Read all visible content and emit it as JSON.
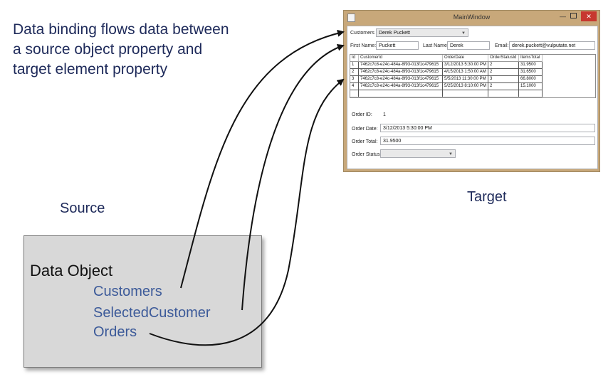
{
  "headline": [
    "Data binding flows data between",
    "a source object property and",
    "target element property"
  ],
  "source_label": "Source",
  "target_label": "Target",
  "data_object": {
    "title": "Data Object",
    "properties": [
      "Customers",
      "SelectedCustomer",
      "Orders"
    ]
  },
  "window": {
    "title": "MainWindow",
    "customers_label": "Customers",
    "customers_value": "Derek Puckett",
    "first_name_label": "First Name:",
    "first_name_value": "Puckett",
    "last_name_label": "Last Name:",
    "last_name_value": "Derek",
    "email_label": "Email:",
    "email_value": "derek.puckett@vulputate.net",
    "grid": {
      "headers": [
        "Id",
        "CustomerId",
        "OrderDate",
        "OrderStatusId",
        "ItemsTotal"
      ],
      "rows": [
        [
          "1",
          "7462c7c8-e24c-484a-8f93-013f1c479615",
          "3/12/2013 5:30:00 PM",
          "2",
          "31.9500"
        ],
        [
          "2",
          "7462c7c8-e24c-484a-8f93-013f1c479615",
          "4/15/2013 1:50:00 AM",
          "2",
          "31.6500"
        ],
        [
          "3",
          "7462c7c8-e24c-484a-8f93-013f1c479615",
          "5/5/2013 11:30:00 PM",
          "3",
          "66.8000"
        ],
        [
          "4",
          "7462c7c8-e24c-484a-8f93-013f1c479615",
          "5/25/2013 8:10:00 PM",
          "2",
          "15.1000"
        ]
      ]
    },
    "order_id_label": "Order ID:",
    "order_id_value": "1",
    "order_date_label": "Order Date:",
    "order_date_value": "3/12/2013 5:30:00 PM",
    "order_total_label": "Order Total:",
    "order_total_value": "31.9500",
    "order_status_label": "Order Status:",
    "order_status_value": ""
  },
  "colors": {
    "headline_text": "#1e2a5a",
    "property_text": "#3c5a99",
    "box_fill": "#d8d8d8",
    "window_frame": "#c8a87a",
    "close_button": "#c7372f"
  }
}
